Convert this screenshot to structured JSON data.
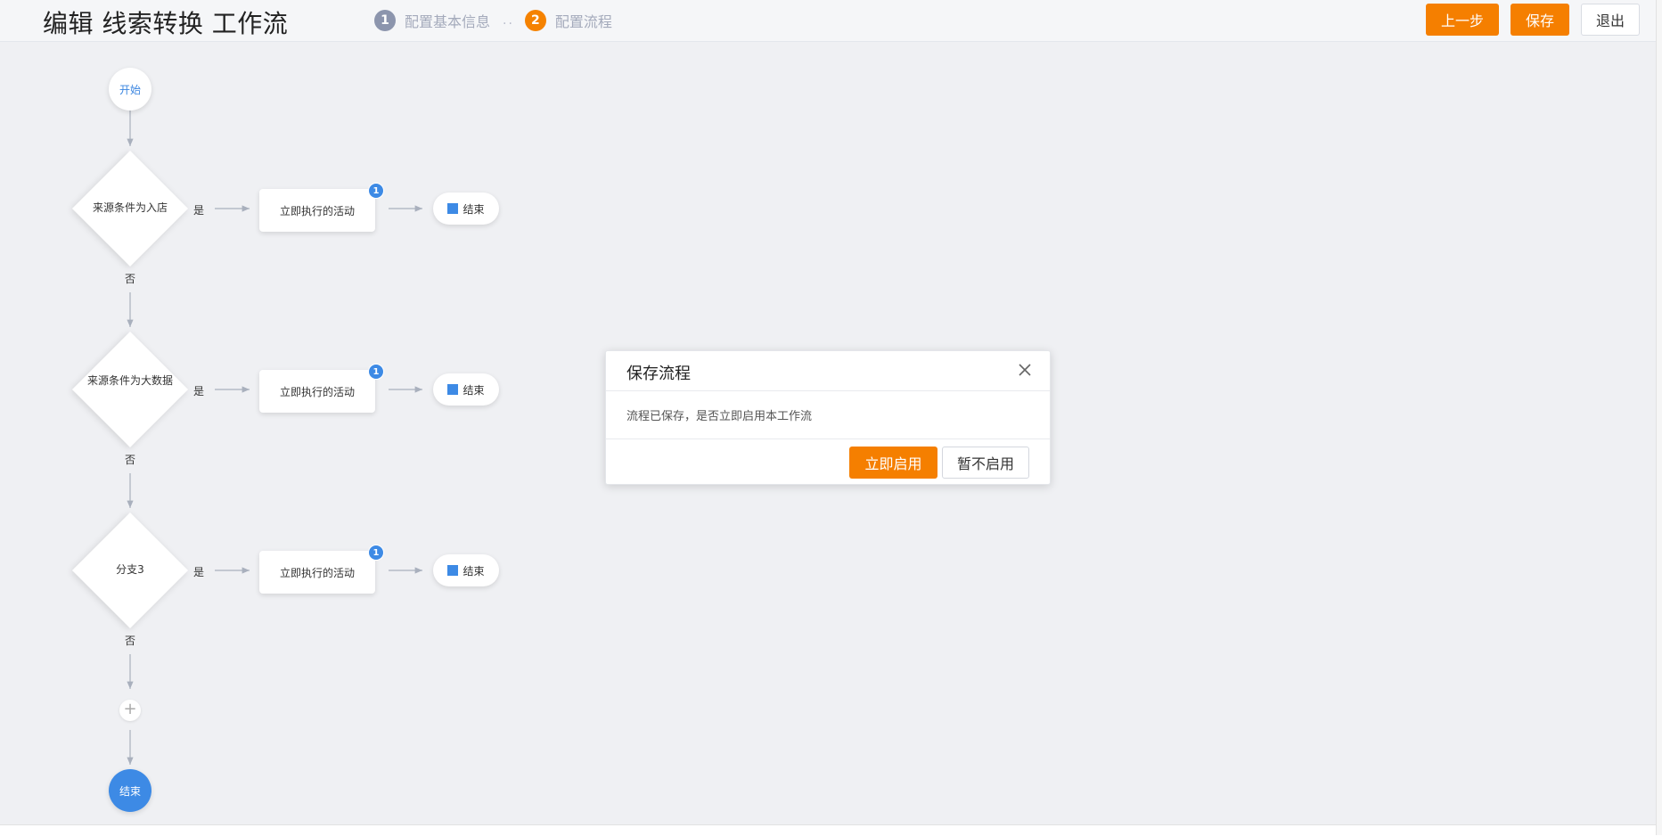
{
  "header": {
    "title": "编辑 线索转换 工作流",
    "steps": [
      {
        "num": "1",
        "label": "配置基本信息"
      },
      {
        "num": "2",
        "label": "配置流程"
      }
    ],
    "step_separator": "..",
    "prev_label": "上一步",
    "save_label": "保存",
    "exit_label": "退出"
  },
  "flow": {
    "start_label": "开始",
    "end_label": "结束",
    "yes_label": "是",
    "no_label": "否",
    "plus_label": "+",
    "branches": [
      {
        "condition": "来源条件为入店",
        "activity": "立即执行的活动",
        "badge": "1",
        "end": "结束"
      },
      {
        "condition": "来源条件为大数据",
        "activity": "立即执行的活动",
        "badge": "1",
        "end": "结束"
      },
      {
        "condition": "分支3",
        "activity": "立即执行的活动",
        "badge": "1",
        "end": "结束"
      }
    ]
  },
  "modal": {
    "title": "保存流程",
    "message": "流程已保存，是否立即启用本工作流",
    "confirm_label": "立即启用",
    "cancel_label": "暂不启用"
  },
  "colors": {
    "accent_orange": "#f57f00",
    "node_blue": "#3d8ae5",
    "canvas_bg": "#eff0f3"
  }
}
